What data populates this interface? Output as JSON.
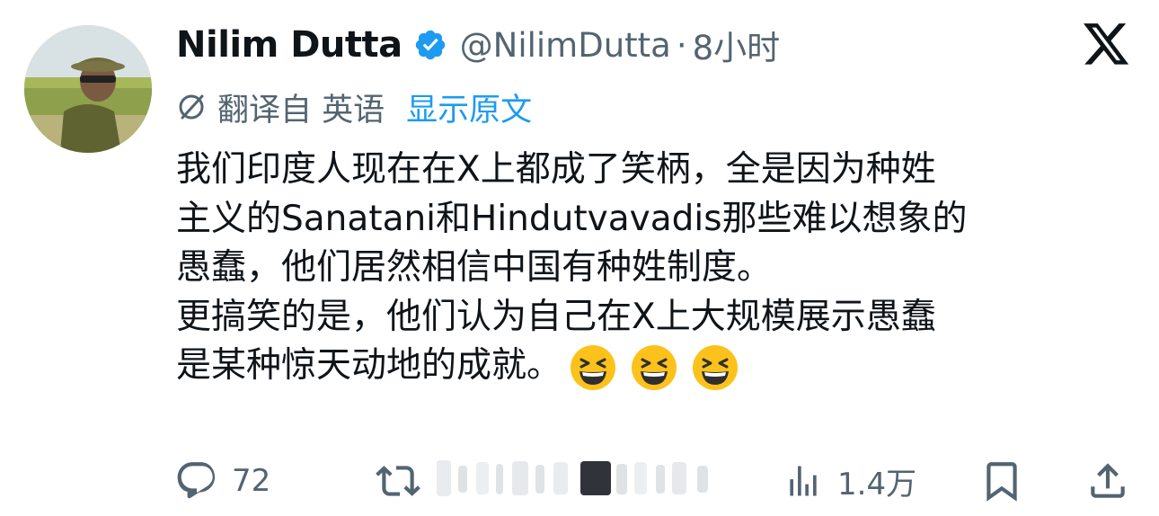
{
  "user": {
    "name": "Nilim Dutta",
    "handle": "@NilimDutta",
    "separator": "·",
    "time": "8小时"
  },
  "translation": {
    "label": "翻译自 英语",
    "show_original": "显示原文"
  },
  "post": {
    "lines": [
      "我们印度人现在在X上都成了笑柄，全是因为种姓",
      "主义的Sanatani和Hindutvavadis那些难以想象的",
      "愚蠢，他们居然相信中国有种姓制度。",
      "更搞笑的是，他们认为自己在X上大规模展示愚蠢",
      "是某种惊天动地的成就。"
    ],
    "emoji": [
      "grinning-squinting-face",
      "grinning-squinting-face",
      "grinning-squinting-face"
    ]
  },
  "actions": {
    "reply_count": "72",
    "views_count": "1.4万"
  },
  "icons": {
    "verified": "verified-badge-icon",
    "platform": "x-logo-icon",
    "translate": "translate-icon",
    "reply": "reply-icon",
    "repost": "repost-icon",
    "views": "views-icon",
    "bookmark": "bookmark-icon",
    "share": "share-icon"
  },
  "colors": {
    "text": "#0f1419",
    "secondary": "#536471",
    "accent": "#1d9bf0"
  }
}
